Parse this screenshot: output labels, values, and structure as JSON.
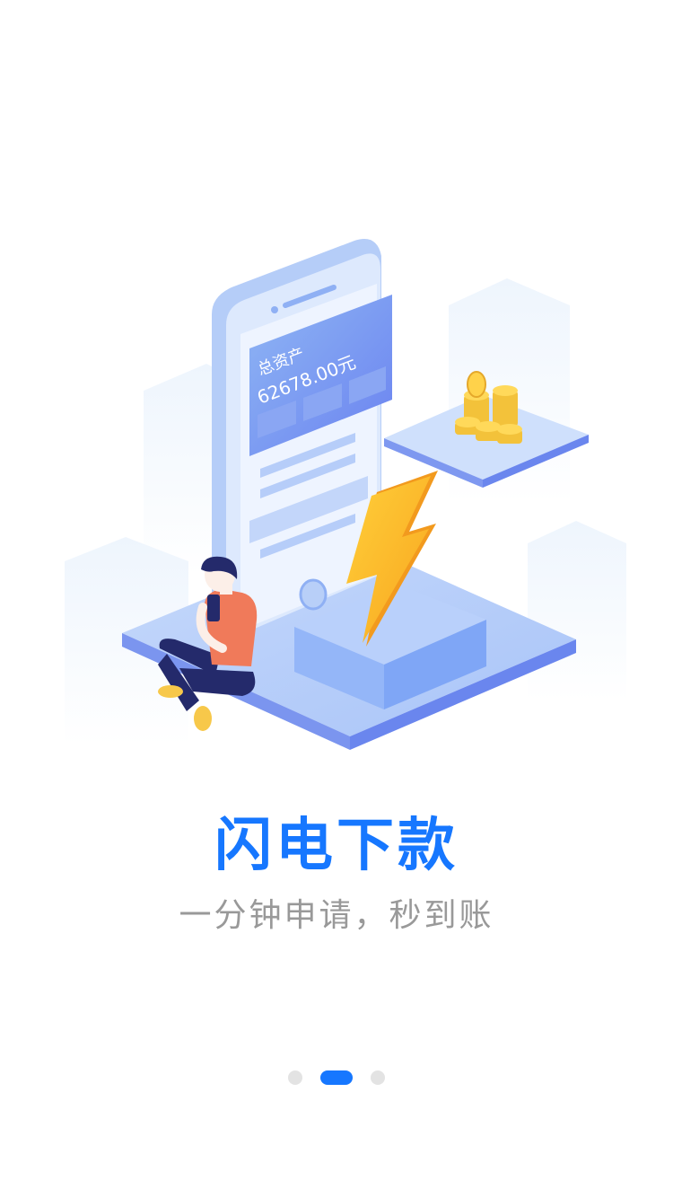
{
  "slide": {
    "title": "闪电下款",
    "subtitle": "一分钟申请，秒到账"
  },
  "illustration": {
    "card_label": "总资产",
    "card_amount": "62678.00元"
  },
  "pager": {
    "total": 3,
    "active_index": 1
  },
  "colors": {
    "accent": "#1677ff",
    "subtitle": "#999999",
    "dot_inactive": "#e3e3e3"
  }
}
